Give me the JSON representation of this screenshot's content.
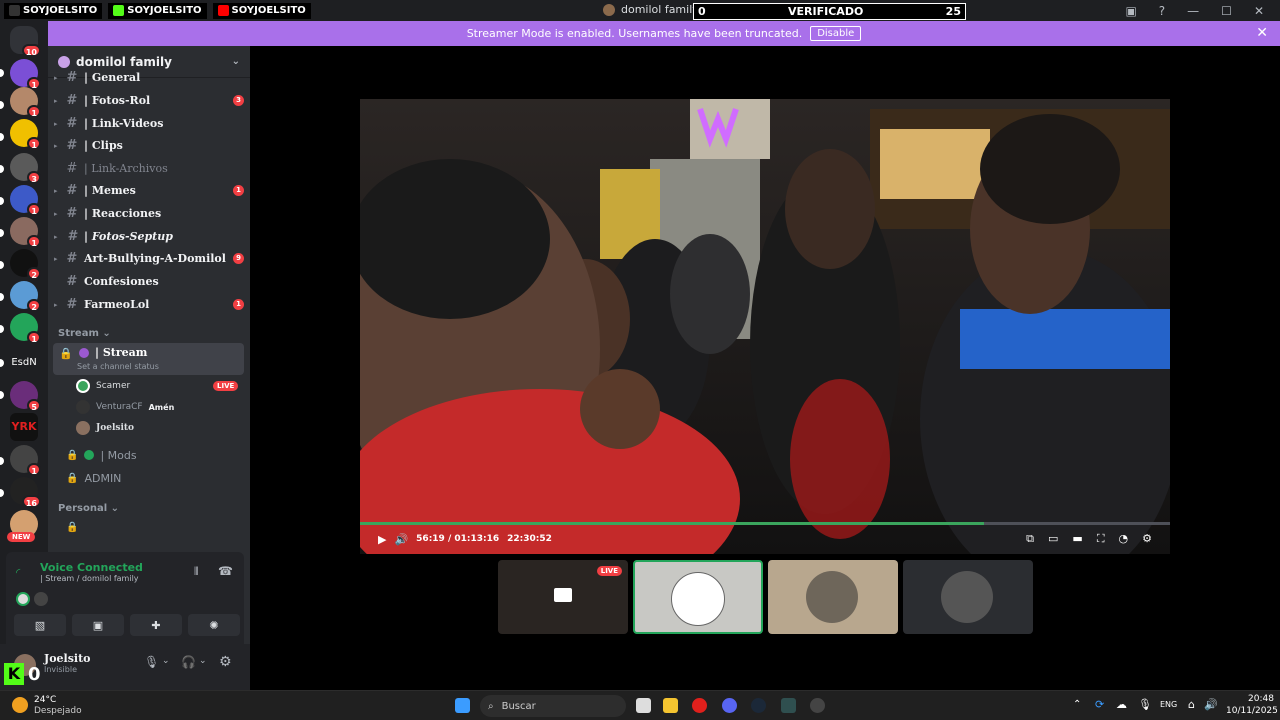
{
  "overlay": {
    "brand1": "SOYJOELSITO",
    "brand2": "SOYJOELSITO",
    "brand3": "SOYJOELSITO",
    "server_title": "domilol family",
    "verif_left": "0",
    "verif_label": "VERIFICADO",
    "verif_right": "25"
  },
  "banner": {
    "text": "Streamer Mode is enabled. Usernames have been truncated.",
    "button": "Disable"
  },
  "server": {
    "name": "domilol family"
  },
  "channels": [
    {
      "name": "| General",
      "badge": "",
      "dim": false
    },
    {
      "name": "| Fotos-Rol",
      "badge": "3",
      "dim": false
    },
    {
      "name": "| Link-Videos",
      "badge": "",
      "dim": false
    },
    {
      "name": "| Clips",
      "badge": "",
      "dim": false
    },
    {
      "name": "| Link-Archivos",
      "badge": "",
      "dim": true
    },
    {
      "name": "| Memes",
      "badge": "1",
      "dim": false
    },
    {
      "name": "| Reacciones",
      "badge": "",
      "dim": false
    },
    {
      "name": "| Fotos-Septup",
      "badge": "",
      "dim": false
    },
    {
      "name": "Art-Bullying-A-Domilol",
      "badge": "9",
      "dim": false
    },
    {
      "name": "Confesiones",
      "badge": "",
      "dim": false
    },
    {
      "name": "FarmeoLol",
      "badge": "1",
      "dim": false
    }
  ],
  "categories": {
    "stream": "Stream",
    "personal": "Personal"
  },
  "stream_channel": {
    "name": "| Stream",
    "status": "Set a channel status"
  },
  "voice_users": [
    {
      "name": "Scamer",
      "live": "LIVE"
    },
    {
      "name": "VenturaCF",
      "extra": "Amén"
    },
    {
      "name": "Joelsito"
    }
  ],
  "other_channels": {
    "mods": "| Mods",
    "admin": "ADMIN"
  },
  "voice": {
    "status": "Voice Connected",
    "location": "| Stream / domilol family"
  },
  "user": {
    "name": "Joelsito",
    "status": "Invisible"
  },
  "kick_count": "0",
  "guild_badges": [
    "10",
    "1",
    "1",
    "1",
    "3",
    "1",
    "1",
    "2",
    "2",
    "1",
    "5",
    "1",
    "16"
  ],
  "new_label": "NEW",
  "guild_text": {
    "esdn": "EsdN",
    "yrk": "YRK"
  },
  "player": {
    "time": "56:19 / 01:13:16",
    "clock": "22:30:52",
    "progress": 0.77
  },
  "tiles": {
    "live": "LIVE"
  },
  "taskbar": {
    "weather_temp": "24°C",
    "weather_desc": "Despejado",
    "search": "Buscar",
    "lang": "ENG",
    "time": "20:48",
    "date": "10/11/2025"
  },
  "colors": {
    "accent": "#a970ea",
    "live": "#f23f43",
    "voice": "#23a55a",
    "kick": "#53fc18"
  }
}
